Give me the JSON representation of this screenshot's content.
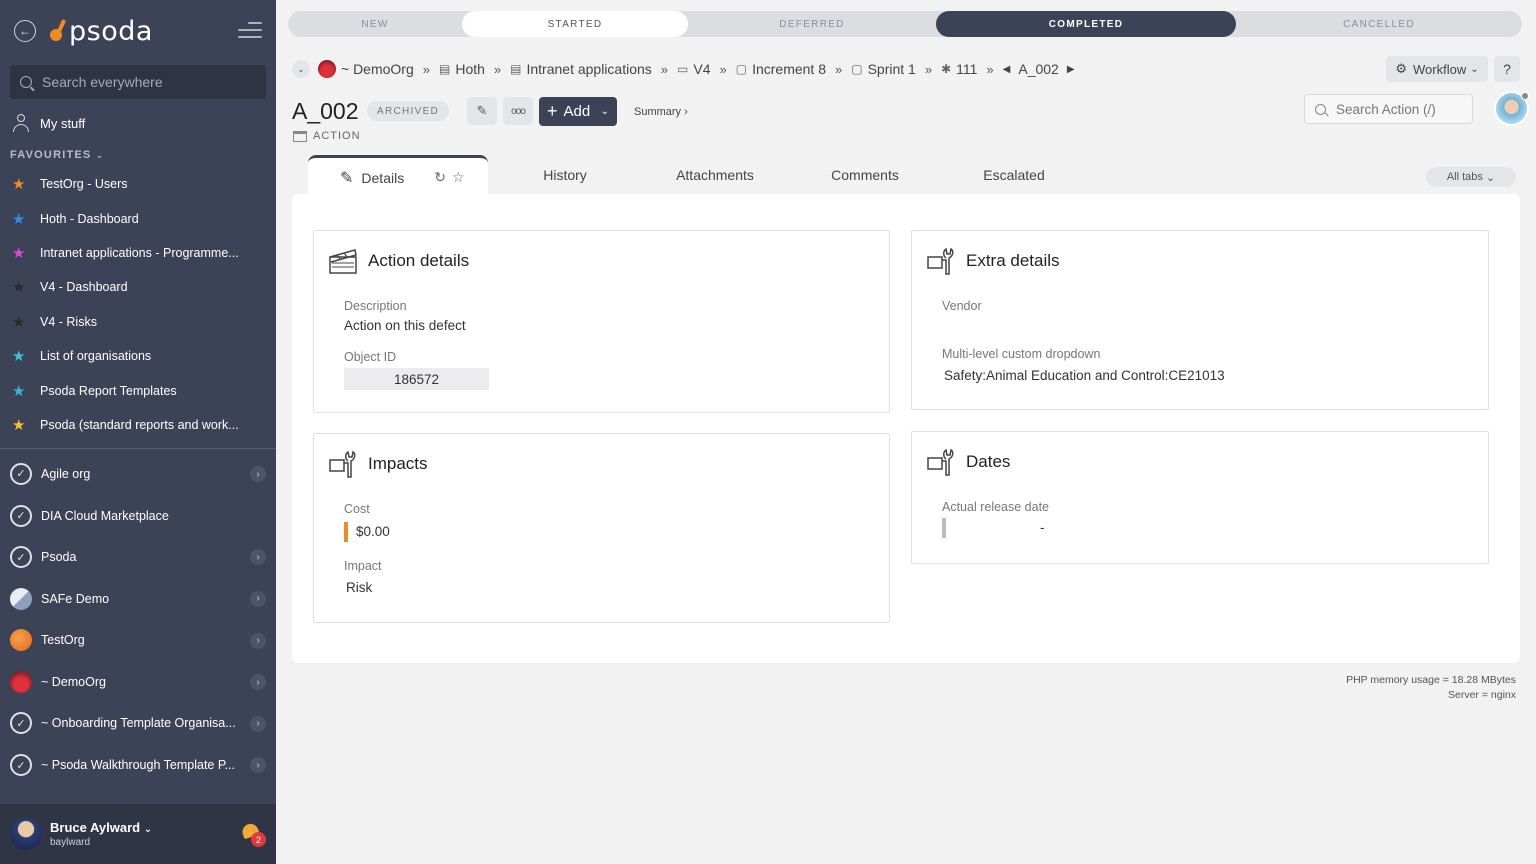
{
  "sidebar": {
    "logo_text": "psoda",
    "search_placeholder": "Search everywhere",
    "my_stuff": "My stuff",
    "favourites_heading": "FAVOURITES",
    "favourites": [
      {
        "label": "TestOrg - Users",
        "star_color": "#f08a24"
      },
      {
        "label": "Hoth - Dashboard",
        "star_color": "#3a86e8"
      },
      {
        "label": "Intranet applications - Programme...",
        "star_color": "#d64bd6"
      },
      {
        "label": "V4 - Dashboard",
        "star_color": "#2b2b2b"
      },
      {
        "label": "V4 - Risks",
        "star_color": "#2b2b2b"
      },
      {
        "label": "List of organisations",
        "star_color": "#3bc2d8"
      },
      {
        "label": "Psoda Report Templates",
        "star_color": "#3bb1e0"
      },
      {
        "label": "Psoda (standard reports and work...",
        "star_color": "#f2c230"
      }
    ],
    "orgs": [
      {
        "label": "Agile org",
        "icon": "psoda",
        "has_arrow": true
      },
      {
        "label": "DIA Cloud Marketplace",
        "icon": "psoda",
        "has_arrow": false
      },
      {
        "label": "Psoda",
        "icon": "psoda",
        "has_arrow": true
      },
      {
        "label": "SAFe Demo",
        "icon": "safe",
        "has_arrow": true
      },
      {
        "label": "TestOrg",
        "icon": "test",
        "has_arrow": true
      },
      {
        "label": "~ DemoOrg",
        "icon": "demo",
        "has_arrow": true
      },
      {
        "label": "~ Onboarding Template Organisa...",
        "icon": "psoda",
        "has_arrow": true
      },
      {
        "label": "~ Psoda Walkthrough Template P...",
        "icon": "psoda",
        "has_arrow": true
      }
    ],
    "user": {
      "name": "Bruce Aylward",
      "username": "baylward",
      "notification_count": "2"
    }
  },
  "status_bar": {
    "segments": [
      "NEW",
      "STARTED",
      "DEFERRED",
      "COMPLETED",
      "CANCELLED"
    ],
    "active": "COMPLETED"
  },
  "breadcrumb": {
    "items": [
      "~ DemoOrg",
      "Hoth",
      "Intranet applications",
      "V4",
      "Increment 8",
      "Sprint 1",
      "111"
    ],
    "current": "A_002",
    "separator": "»"
  },
  "header": {
    "workflow_label": "Workflow",
    "help_label": "?",
    "title": "A_002",
    "archived_badge": "ARCHIVED",
    "object_type": "ACTION",
    "add_label": "Add",
    "summary_link": "Summary",
    "search_placeholder": "Search Action (/)"
  },
  "tabs": {
    "items": [
      "Details",
      "History",
      "Attachments",
      "Comments",
      "Escalated"
    ],
    "active": "Details",
    "all_tabs": "All tabs"
  },
  "cards": {
    "action_details": {
      "title": "Action details",
      "description_label": "Description",
      "description_value": "Action on this defect",
      "object_id_label": "Object ID",
      "object_id_value": "186572"
    },
    "extra_details": {
      "title": "Extra details",
      "vendor_label": "Vendor",
      "dropdown_label": "Multi-level custom dropdown",
      "dropdown_value": "Safety:Animal Education and Control:CE21013"
    },
    "impacts": {
      "title": "Impacts",
      "cost_label": "Cost",
      "cost_value": "$0.00",
      "impact_label": "Impact",
      "impact_value": "Risk"
    },
    "dates": {
      "title": "Dates",
      "release_label": "Actual release date",
      "release_value": "-"
    }
  },
  "footer": {
    "memory": "PHP memory usage = 18.28 MBytes",
    "server": "Server = nginx"
  },
  "colors": {
    "sidebar_bg": "#3c4356",
    "accent_orange": "#f08a24",
    "page_bg": "#f2f2f3"
  }
}
